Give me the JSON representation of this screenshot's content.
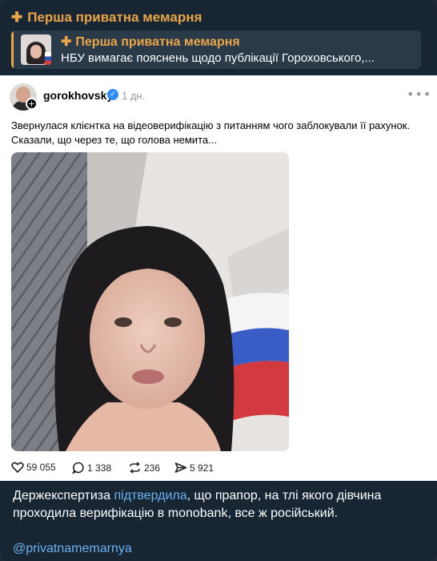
{
  "channel": {
    "sender_name": "Перша приватна мемарня",
    "plus_glyph": "✚"
  },
  "reply": {
    "name": "Перша приватна мемарня",
    "text": "НБУ вимагає пояснень щодо публікації Гороховського,..."
  },
  "post": {
    "username": "gorokhovsky",
    "age": "1 дн.",
    "menu_glyph": "•••",
    "text_line1": "Звернулася клієнтка на відеоверифікацію з питанням чого заблокували її рахунок.",
    "text_line2": "Сказали, що через те, що голова немита...",
    "stats": {
      "likes": "59 055",
      "comments": "1 338",
      "reposts": "236",
      "shares": "5 921"
    }
  },
  "caption": {
    "before": "Держекспертиза ",
    "link": "підтвердила",
    "after": ", що прапор, на тлі якого дівчина проходила верифікацію в monobank, все ж російський."
  },
  "mention": "@privatnamemarnya",
  "colors": {
    "background": "#182533",
    "accent": "#e8a549",
    "link": "#6ab3f3",
    "verified": "#2f8cf5"
  }
}
